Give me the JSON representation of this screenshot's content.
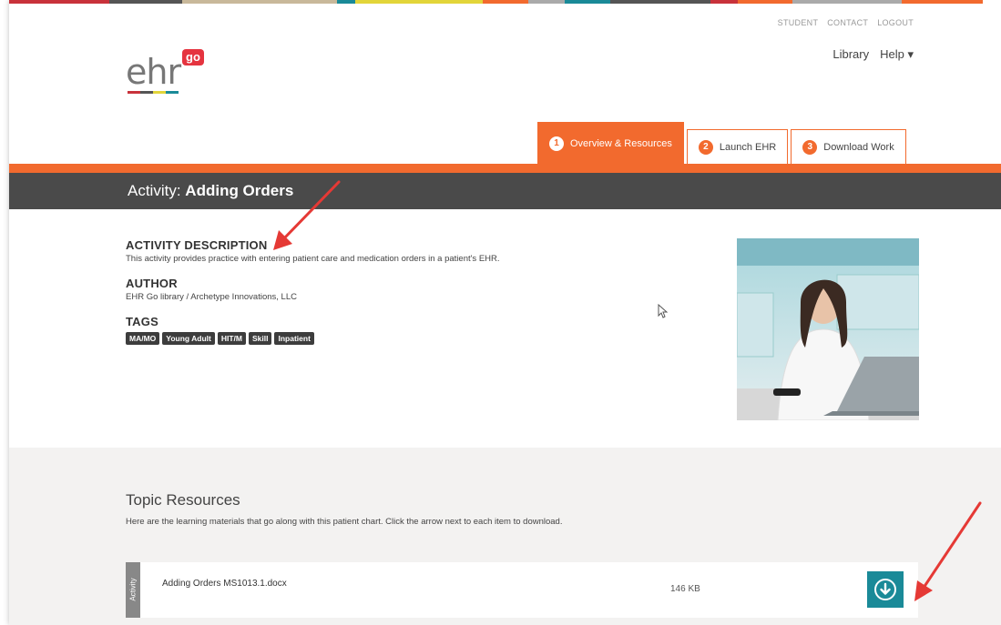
{
  "top_links": [
    "STUDENT",
    "CONTACT",
    "LOGOUT"
  ],
  "logo": {
    "text": "ehr",
    "badge": "go"
  },
  "main_nav": {
    "library": "Library",
    "help": "Help ▾"
  },
  "tabs": [
    {
      "num": "1",
      "label": "Overview & Resources",
      "active": true
    },
    {
      "num": "2",
      "label": "Launch EHR",
      "active": false
    },
    {
      "num": "3",
      "label": "Download Work",
      "active": false
    }
  ],
  "activity": {
    "prefix": "Activity:",
    "title": "Adding Orders"
  },
  "description": {
    "heading": "ACTIVITY DESCRIPTION",
    "text": "This activity provides practice with entering patient care and medication orders in a patient's EHR."
  },
  "author": {
    "heading": "AUTHOR",
    "text": "EHR Go library / Archetype Innovations, LLC"
  },
  "tags": {
    "heading": "TAGS",
    "items": [
      "MA/MO",
      "Young Adult",
      "HIT/M",
      "Skill",
      "Inpatient"
    ]
  },
  "resources": {
    "title": "Topic Resources",
    "subtitle": "Here are the learning materials that go along with this patient chart. Click the arrow next to each item to download.",
    "items": [
      {
        "category": "Activity",
        "name": "Adding Orders MS1013.1.docx",
        "size": "146 KB"
      }
    ]
  },
  "colors": {
    "accent": "#f26a2e",
    "header": "#4a4a4a",
    "download": "#1a8a98",
    "annotation": "#e53935"
  }
}
